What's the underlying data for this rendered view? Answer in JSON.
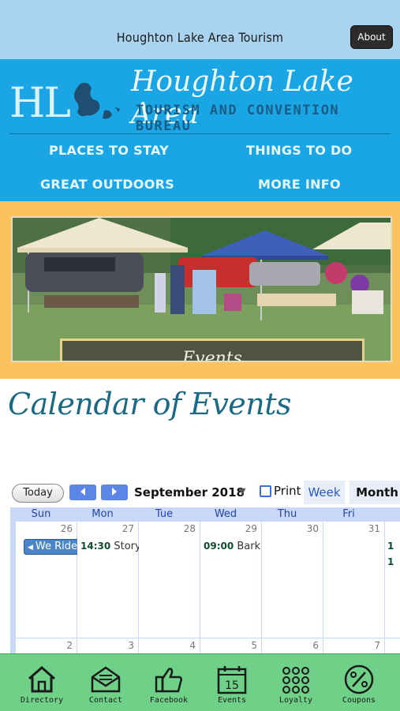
{
  "topbar": {
    "title": "Houghton Lake Area Tourism",
    "about_label": "About"
  },
  "header": {
    "logo_initials": "HL",
    "logo_script": "Houghton Lake Area",
    "logo_sub": "TOURISM AND CONVENTION BUREAU",
    "nav": {
      "places": "PLACES TO STAY",
      "things": "THINGS TO DO",
      "outdoors": "GREAT OUTDOORS",
      "more": "MORE INFO"
    }
  },
  "banner": {
    "events_label": "Events"
  },
  "calendar_heading": "Calendar of Events",
  "calendar": {
    "today_label": "Today",
    "month_label": "September 2018",
    "print_label": "Print",
    "week_tab": "Week",
    "month_tab": "Month",
    "days": [
      "Sun",
      "Mon",
      "Tue",
      "Wed",
      "Thu",
      "Fri"
    ],
    "row1_dates": [
      "26",
      "27",
      "28",
      "29",
      "30",
      "31"
    ],
    "row2_dates": [
      "2",
      "3",
      "4",
      "5",
      "6",
      "7"
    ],
    "events": {
      "sun": "We Ride",
      "mon_time": "14:30",
      "mon_title": "Story",
      "wed_time": "09:00",
      "wed_title": "Bark i",
      "fri_a": "1",
      "fri_b": "1"
    }
  },
  "tabbar": {
    "directory": "Directory",
    "contact": "Contact",
    "facebook": "Facebook",
    "events": "Events",
    "events_day": "15",
    "loyalty": "Loyalty",
    "coupons": "Coupons"
  },
  "colors": {
    "topbar": "#a9d3ef",
    "header": "#1aa6e4",
    "banner_frame": "#fbc35d",
    "tabbar": "#6fd188"
  }
}
